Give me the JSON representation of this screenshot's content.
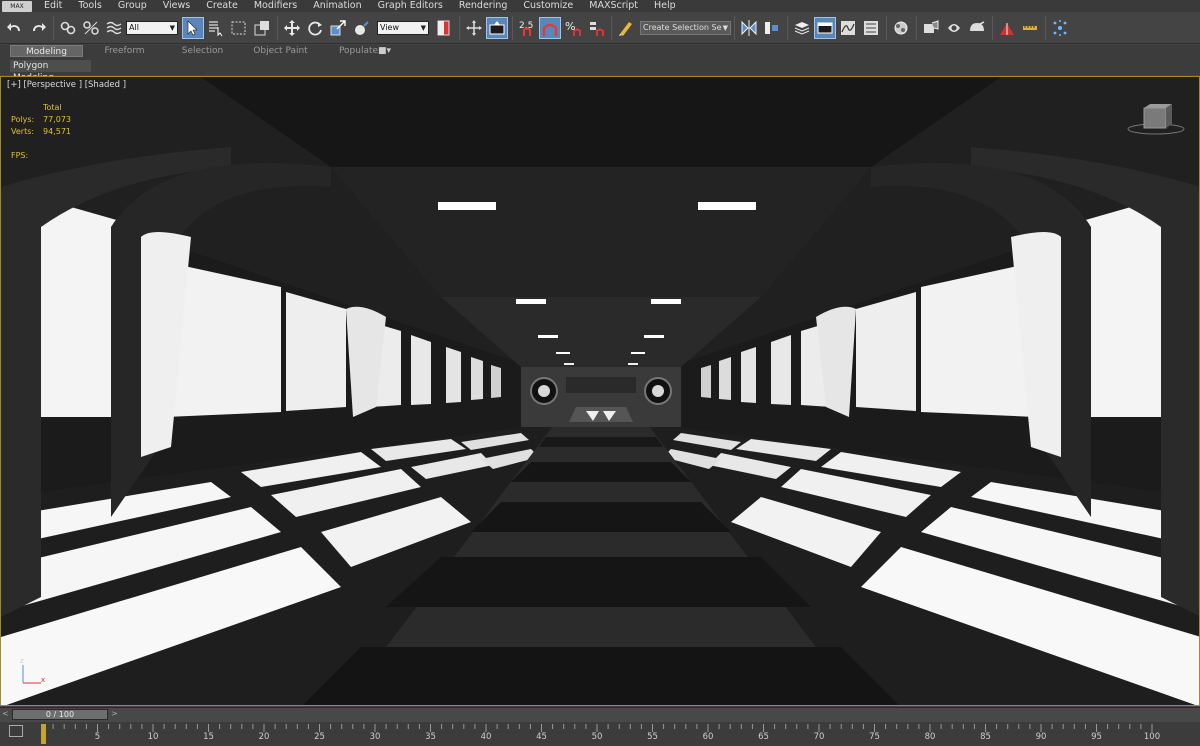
{
  "menu": {
    "logo": "MAX",
    "items": [
      "Edit",
      "Tools",
      "Group",
      "Views",
      "Create",
      "Modifiers",
      "Animation",
      "Graph Editors",
      "Rendering",
      "Customize",
      "MAXScript",
      "Help"
    ]
  },
  "toolbar": {
    "selection_filter": "All",
    "reference_coordinate": "View",
    "snap_value": "2.5",
    "named_selection_placeholder": "Create Selection Se"
  },
  "ribbon": {
    "tabs": [
      "Modeling",
      "Freeform",
      "Selection",
      "Object Paint",
      "Populate"
    ],
    "active_tab": "Modeling",
    "panel_label": "Polygon Modeling"
  },
  "viewport": {
    "label": "[+] [Perspective ] [Shaded ]",
    "stats": {
      "header": "Total",
      "polys_label": "Polys:",
      "polys": "77,073",
      "verts_label": "Verts:",
      "verts": "94,571",
      "fps_label": "FPS:"
    },
    "axis": {
      "z": "z",
      "x": "x"
    }
  },
  "timeline": {
    "slider": "0 / 100",
    "prev": "<",
    "next": ">",
    "ticks": [
      "5",
      "10",
      "15",
      "20",
      "25",
      "30",
      "35",
      "40",
      "45",
      "50",
      "55",
      "60",
      "65",
      "70",
      "75",
      "80",
      "85",
      "90",
      "95",
      "100"
    ]
  },
  "colors": {
    "active_tool": "#5a86b8",
    "viewport_border": "#a08a2c",
    "stats_text": "#e3c12a"
  }
}
